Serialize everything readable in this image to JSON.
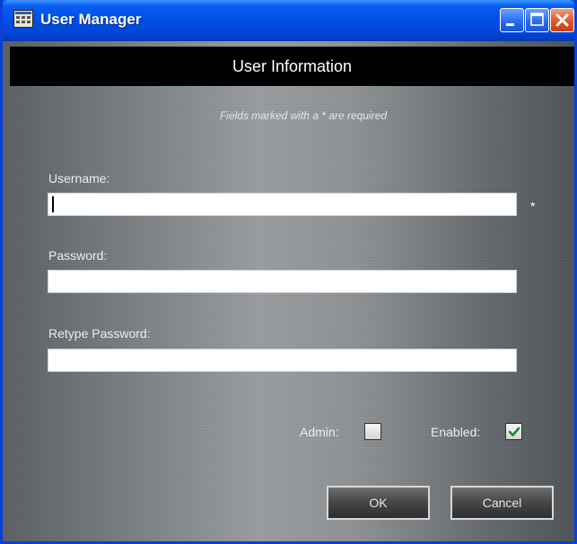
{
  "window": {
    "title": "User Manager",
    "icon": "grid-app-icon",
    "title_controls": [
      "minimize-icon",
      "maximize-icon",
      "close-icon"
    ]
  },
  "header": {
    "title": "User Information"
  },
  "form": {
    "required_note": "Fields marked with a * are required",
    "username": {
      "label": "Username:",
      "value": "",
      "required_marker": "*"
    },
    "password": {
      "label": "Password:",
      "value": ""
    },
    "retype_password": {
      "label": "Retype Password:",
      "value": ""
    },
    "admin": {
      "label": "Admin:",
      "checked": false
    },
    "enabled": {
      "label": "Enabled:",
      "checked": true
    }
  },
  "buttons": {
    "ok": "OK",
    "cancel": "Cancel"
  },
  "colors": {
    "titlebar": "#0054e3",
    "header_band": "#000000",
    "checkmark": "#1a8a2a",
    "close_button": "#e05a2e"
  }
}
